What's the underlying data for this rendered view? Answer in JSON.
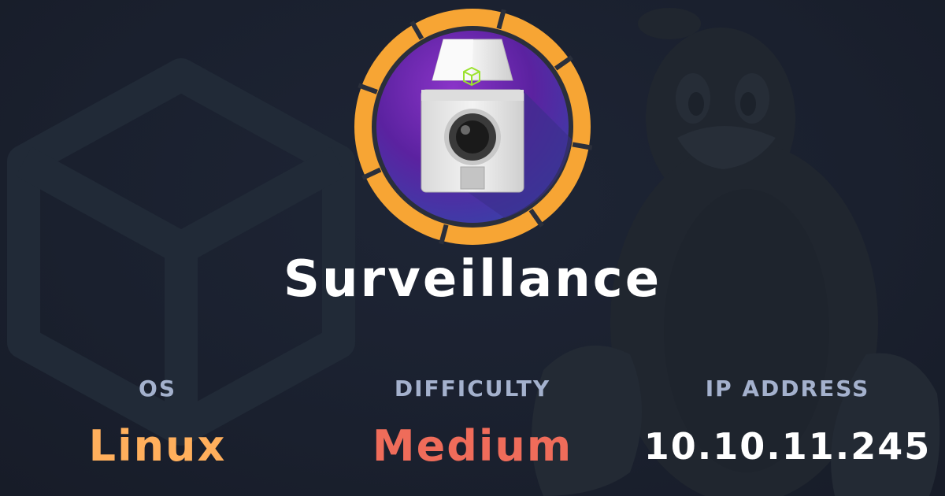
{
  "machine": {
    "name": "Surveillance",
    "avatar_icon": "security-camera-icon",
    "ring_color": "#f7a534",
    "inner_color": "#6a2aa8"
  },
  "stats": {
    "os_label": "OS",
    "os_value": "Linux",
    "difficulty_label": "DIFFICULTY",
    "difficulty_value": "Medium",
    "ip_label": "IP ADDRESS",
    "ip_value": "10.10.11.245"
  },
  "background": {
    "left_icon": "hexagon-cube-icon",
    "right_icon": "linux-penguin-icon",
    "base_color": "#1b2130"
  },
  "colors": {
    "os": "#ffaf5c",
    "difficulty": "#ef6c5a",
    "label": "#a4b1cd",
    "title": "#ffffff"
  }
}
